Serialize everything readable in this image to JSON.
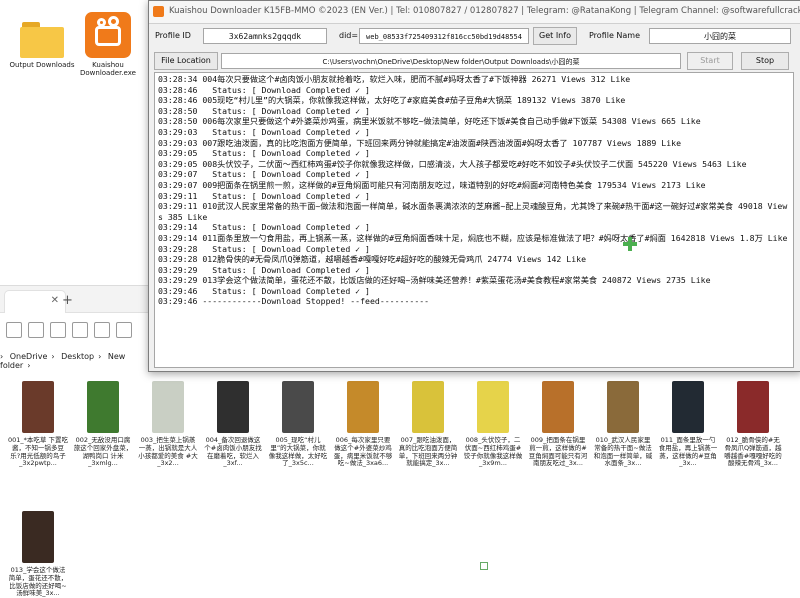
{
  "desktop": {
    "icons": [
      {
        "label": "Output Downloads",
        "icon": "folder-icon"
      },
      {
        "label": "Kuaishou Downloader.exe",
        "icon": "kuaishou-app-icon"
      }
    ]
  },
  "explorer": {
    "path": [
      "OneDrive",
      "Desktop",
      "New folder"
    ],
    "thumbnails": [
      {
        "label": "001_*本吃草 下置吃酱，不知一锅多豆乐?用光低额的鸟子_3x2pwtp...",
        "color": "#6a3a2a"
      },
      {
        "label": "002_无敌没用口腐旅这个回家外盘菜，湖鸭岗口 计米_3xmlg...",
        "color": "#3f7a2f"
      },
      {
        "label": "003_把生菜上锅蒸一蒸，出锅就是大人小孩都爱的美食 #大_3x2...",
        "color": "#c9cfc4"
      },
      {
        "label": "004_备次回退做这个#卤肉饭小朋友找在磨着吃，软烂入_3xf...",
        "color": "#2f2f2f"
      },
      {
        "label": "005_现吃“村儿里”的大锅菜，你就像我这样做，太好吃了_3x5c...",
        "color": "#4a4a4a"
      },
      {
        "label": "006_每次家里只要做这个#外婆菜炒鸡蛋，病里米饭就不够吃~做法_3xa6...",
        "color": "#c58a2a"
      },
      {
        "label": "007_跟吃油泼面，真的比吃泡面方便简单，下班回来两分钟就能搞定_3x...",
        "color": "#d9c23a"
      },
      {
        "label": "008_头伏饺子，二伏面~西红柿鸡蛋#饺子你就像我这样做_3x9m...",
        "color": "#e6d34a"
      },
      {
        "label": "009_把面条在锅里煎一煎，这样做的#豆角焖面可能只有河南朋友吃过_3x...",
        "color": "#b8702a"
      },
      {
        "label": "010_武汉人民家里常备的热干面~做法和泡面一样简单，碱水面条_3x...",
        "color": "#8a6a3a"
      },
      {
        "label": "011_面条里放一勺食用盐，再上锅蒸一蒸，这样做的#豆角_3x...",
        "color": "#222a33"
      },
      {
        "label": "012_脆骨侠的#无骨凤爪Q弹筋道，越嚼越香#嘎嘎好吃的酸辣无骨鸡_3x...",
        "color": "#8a2a2a"
      },
      {
        "label": "013_学会这个做法简单，蛋花还不散，比饭店做的还好喝~汤鲜味美_3x...",
        "color": "#3a2a22"
      }
    ]
  },
  "window": {
    "title": "Kuaishou Downloader  K15FB-MMO ©2023 (EN Ver.)  |  Tel: 010807827 / 012807827  |  Telegram: @RatanaKong  |  Telegram Channel: @softwarefullcracked",
    "profile_id_label": "Profile ID",
    "profile_id_value": "3x62amnks2gqqdk",
    "did_label": "did=",
    "did_value": "web_08533f725409312f816cc50bd19d48554",
    "get_info_label": "Get Info",
    "profile_name_label": "Profile Name",
    "profile_name_value": "小囧的菜",
    "file_location_label": "File Location",
    "file_location_value": "C:\\Users\\vochn\\OneDrive\\Desktop\\New folder\\Output Downloads\\小囧的菜",
    "start_label": "Start",
    "stop_label": "Stop"
  },
  "log": [
    "03:28:34 004每次只要做这个#卤肉饭小朋友就抢着吃，软烂入味，肥而不腻#妈呀太香了#下饭神器 26271 Views 312 Like",
    "03:28:46   Status: [ Download Completed ✓ ]",
    "03:28:46 005现吃“村儿里”的大锅菜，你就像我这样做，太好吃了#家庭美食#茄子豆角#大锅菜 189132 Views 3870 Like",
    "03:28:50   Status: [ Download Completed ✓ ]",
    "03:28:50 006每次家里只要做这个#外婆菜炒鸡蛋，病里米饭就不够吃~做法简单，好吃还下饭#美食自己动手做#下饭菜 54308 Views 665 Like",
    "03:29:03   Status: [ Download Completed ✓ ]",
    "03:29:03 007跟吃油泼面，真的比吃泡面方便简单，下班回来两分钟就能搞定#油泼面#陕西油泼面#妈呀太香了 107787 Views 1889 Like",
    "03:29:05   Status: [ Download Completed ✓ ]",
    "03:29:05 008头伏饺子，二伏面～西红柿鸡蛋#饺子你就像我这样做，口感清淡，大人孩子都爱吃#好吃不如饺子#头伏饺子二伏面 545220 Views 5463 Like",
    "03:29:07   Status: [ Download Completed ✓ ]",
    "03:29:07 009把面条在锅里煎一煎，这样做的#豆角焖面可能只有河南朋友吃过，味道特别的好吃#焖面#河南特色美食 179534 Views 2173 Like",
    "03:29:11   Status: [ Download Completed ✓ ]",
    "03:29:11 010武汉人民家里常备的热干面~做法和泡面一样简单，碱水面条裹满浓浓的芝麻酱~配上灵魂酸豆角，尤其馋了来碗#热干面#这一碗好过#家常美食 49018 Views 385 Like",
    "03:29:14   Status: [ Download Completed ✓ ]",
    "03:29:14 011面条里放一勺食用盐，再上锅蒸一蒸，这样做的#豆角焖面香味十足，焖底也不糊，应该是标准做法了吧？#妈呀太香了#焖面 1642818 Views 1.8万 Like",
    "03:29:28   Status: [ Download Completed ✓ ]",
    "03:29:28 012脆骨侠的#无骨凤爪Q弹筋道，越嚼越香#嘎嘎好吃#超好吃的酸辣无骨鸡爪 24774 Views 142 Like",
    "03:29:29   Status: [ Download Completed ✓ ]",
    "03:29:29 013学会这个做法简单，蛋花还不散，比饭店做的还好喝~汤鲜味美还营养！#紫菜蛋花汤#美食教程#家常美食 240872 Views 2735 Like",
    "03:29:46   Status: [ Download Completed ✓ ]",
    "03:29:46 ------------Download Stopped! --feed----------"
  ]
}
